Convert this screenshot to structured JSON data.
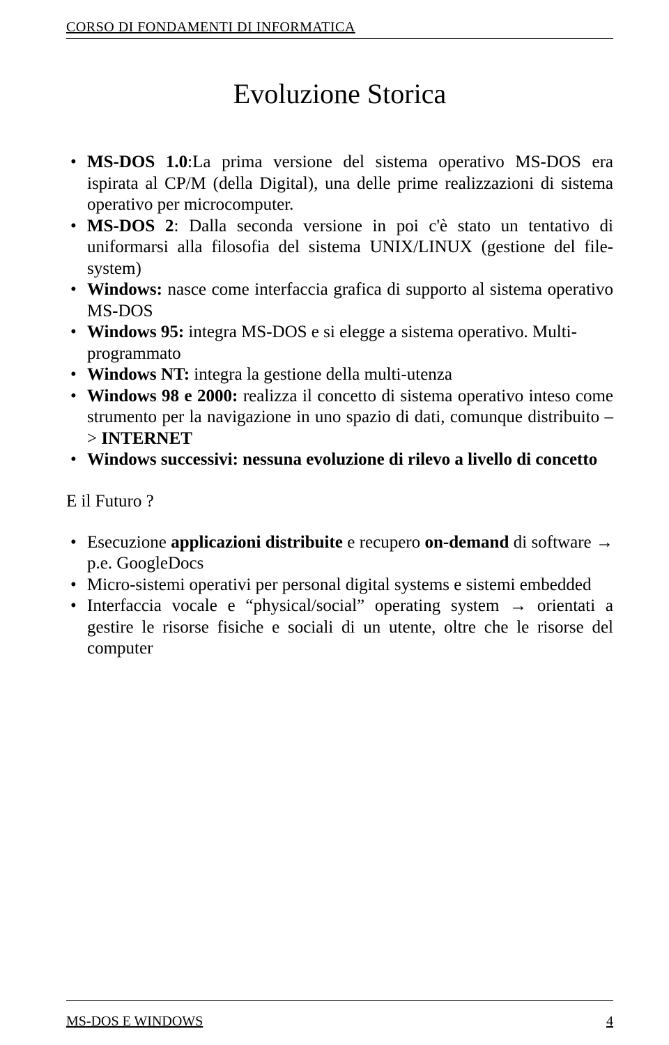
{
  "header": "CORSO DI FONDAMENTI DI INFORMATICA",
  "title": "Evoluzione Storica",
  "list1": {
    "i0_b": "MS-DOS 1.0",
    "i0_t": ":La prima versione del sistema operativo MS-DOS era ispirata al CP/M (della Digital), una delle prime realizzazioni di sistema operativo per microcomputer.",
    "i1_b": "MS-DOS 2",
    "i1_t": ": Dalla seconda versione in poi c'è stato un tentativo di uniformarsi alla filosofia del sistema UNIX/LINUX (gestione del file-system)",
    "i2_b": "Windows:",
    "i2_t": " nasce come interfaccia grafica di supporto al sistema operativo MS-DOS",
    "i3_b": "Windows 95:",
    "i3_t": " integra MS-DOS e si elegge a sistema operativo. Multi-programmato",
    "i4_b": "Windows NT:",
    "i4_t": " integra la gestione della multi-utenza",
    "i5_b": "Windows 98 e 2000:",
    "i5_t": " realizza il concetto di sistema operativo inteso come strumento per la navigazione in uno spazio di dati, comunque distribuito –> ",
    "i5_b2": "INTERNET",
    "i6_b": "Windows successivi: nessuna evoluzione di rilevo a livello di concetto"
  },
  "subhead": "E il Futuro ?",
  "list2": {
    "i0_a": "Esecuzione ",
    "i0_b": "applicazioni distribuite",
    "i0_c": " e recupero ",
    "i0_d": "on-demand",
    "i0_e": " di software → p.e. GoogleDocs",
    "i1": "Micro-sistemi operativi per personal digital systems e sistemi embedded",
    "i2": "Interfaccia vocale e “physical/social” operating system → orientati a gestire le risorse fisiche e sociali di un utente, oltre che le risorse del computer"
  },
  "footer_left": "MS-DOS  E WINDOWS",
  "footer_right": "4"
}
